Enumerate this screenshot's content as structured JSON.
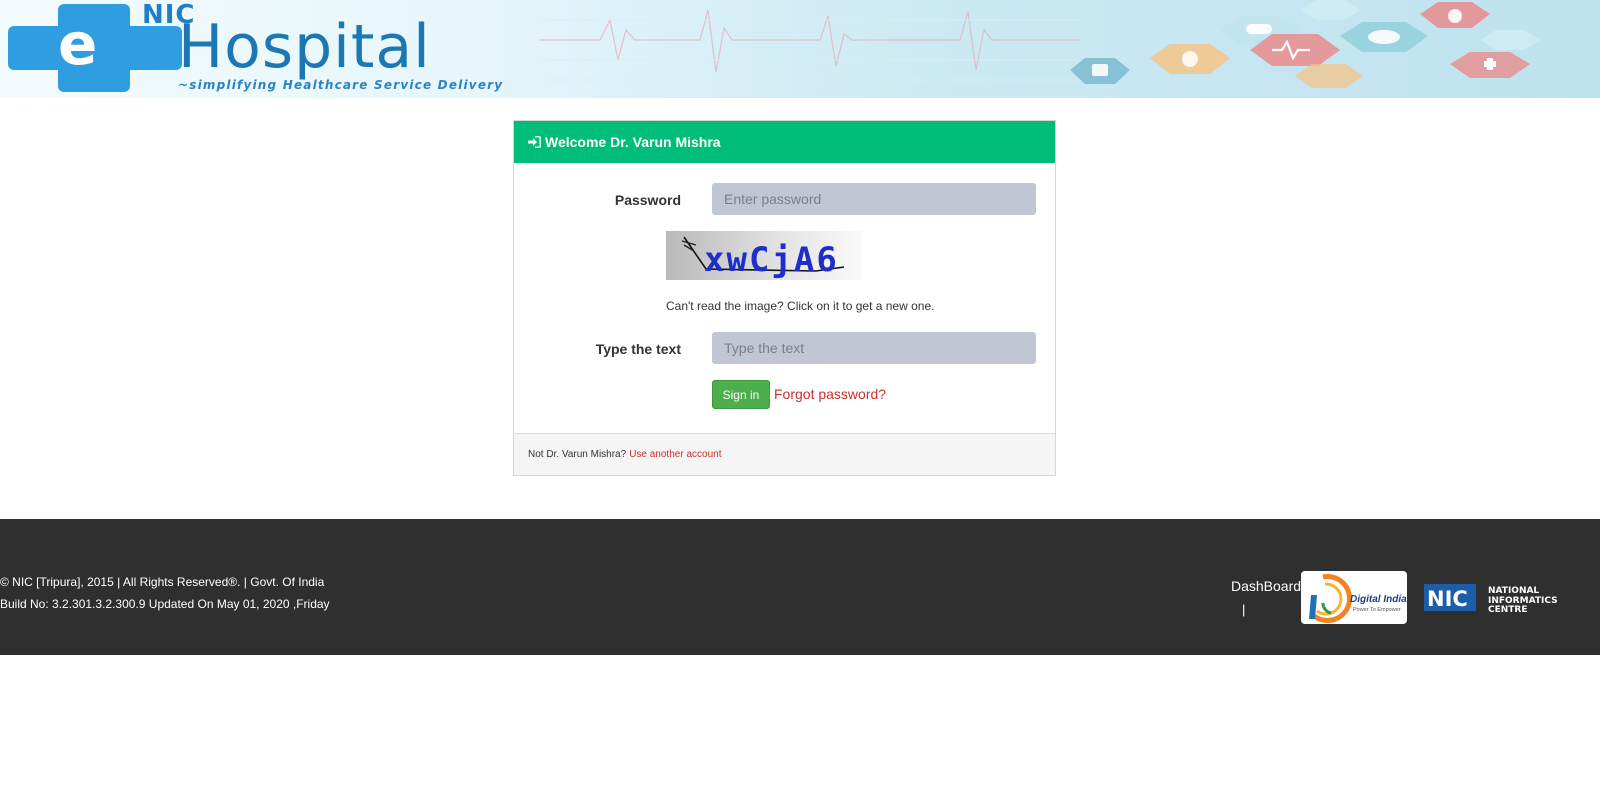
{
  "header": {
    "brand_nic": "NIC",
    "brand_e": "e",
    "brand_hospital": "Hospital",
    "tagline": "~simplifying Healthcare Service Delivery"
  },
  "login": {
    "welcome": "Welcome Dr. Varun Mishra",
    "password_label": "Password",
    "password_placeholder": "Enter password",
    "captcha_text": "xwCjA6",
    "captcha_hint": "Can't read the image? Click on it to get a new one.",
    "captcha_label": "Type the text",
    "captcha_placeholder": "Type the text",
    "signin_label": "Sign in",
    "forgot_label": "Forgot password?",
    "not_user_text": "Not Dr. Varun Mishra?",
    "another_account_label": "Use another account"
  },
  "footer": {
    "copyright": "© NIC [Tripura], 2015 | All Rights Reserved®. | Govt. Of India",
    "build": "Build No: 3.2.301.3.2.300.9 Updated On May 01, 2020 ,Friday",
    "dashboard_label": "DashBoard",
    "separator": "|",
    "digital_india_title": "Digital India",
    "digital_india_sub": "Power To Empower",
    "nic_short": "NIC",
    "nic_line1": "NATIONAL",
    "nic_line2": "INFORMATICS",
    "nic_line3": "CENTRE"
  },
  "colors": {
    "panel_header": "#00bd7a",
    "signin_button": "#4cae4c",
    "link": "#c9302c",
    "footer_bg": "#2f2f2f",
    "brand_blue": "#1b78b5"
  }
}
